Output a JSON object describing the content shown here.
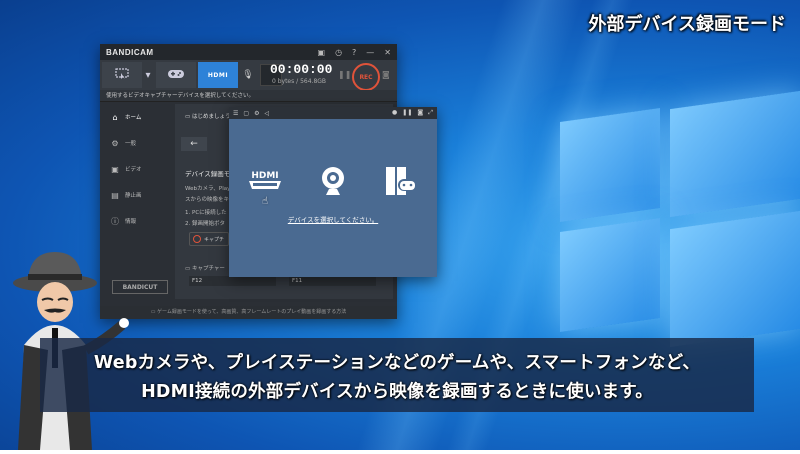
{
  "overlay_title": "外部デバイス録画モード",
  "bandicam": {
    "logo": "BANDICAM",
    "window_icons": {
      "menu": "▣",
      "clock": "◷",
      "help": "?",
      "minimize": "—",
      "close": "✕"
    },
    "modes": [
      {
        "name": "screen",
        "icon": "screen-icon"
      },
      {
        "name": "game",
        "icon": "gamepad-icon"
      },
      {
        "name": "hdmi",
        "label": "HDMI",
        "active": true
      }
    ],
    "timer": "00:00:00",
    "size": "0 bytes / 564.8GB",
    "rec_label": "REC",
    "status": "使用するビデオキャプチャーデバイスを選択してください。",
    "sidebar": [
      {
        "label": "ホーム",
        "icon": "home-icon",
        "active": true
      },
      {
        "label": "一般",
        "icon": "gear-icon"
      },
      {
        "label": "ビデオ",
        "icon": "video-icon"
      },
      {
        "label": "静止画",
        "icon": "image-icon"
      },
      {
        "label": "情報",
        "icon": "info-icon"
      }
    ],
    "cut_label": "BANDICUT",
    "main": {
      "header": "はじめましょう",
      "section_title": "デバイス録画モ",
      "line1": "Webカメラ、Play",
      "line2": "スからの映像をキ",
      "step1": "1. PCに接続した",
      "step2": "2. 録画開始ボタ",
      "capture_btn": "キャプチ",
      "hotkey_label": "キャプチャー",
      "key1": "F12",
      "key2": "F11"
    },
    "footer": "ゲーム録画モードを使って、高画質、高フレームレートのプレイ動画を録画する方法"
  },
  "popup": {
    "label": "デバイスを選択してください。",
    "devices": [
      "hdmi-device-icon",
      "webcam-device-icon",
      "console-device-icon"
    ],
    "hdmi_text": "HDMI"
  },
  "subtitle": {
    "line1": "Webカメラや、プレイステーションなどのゲームや、スマートフォンなど、",
    "line2": "HDMI接続の外部デバイスから映像を録画するときに使います。"
  }
}
